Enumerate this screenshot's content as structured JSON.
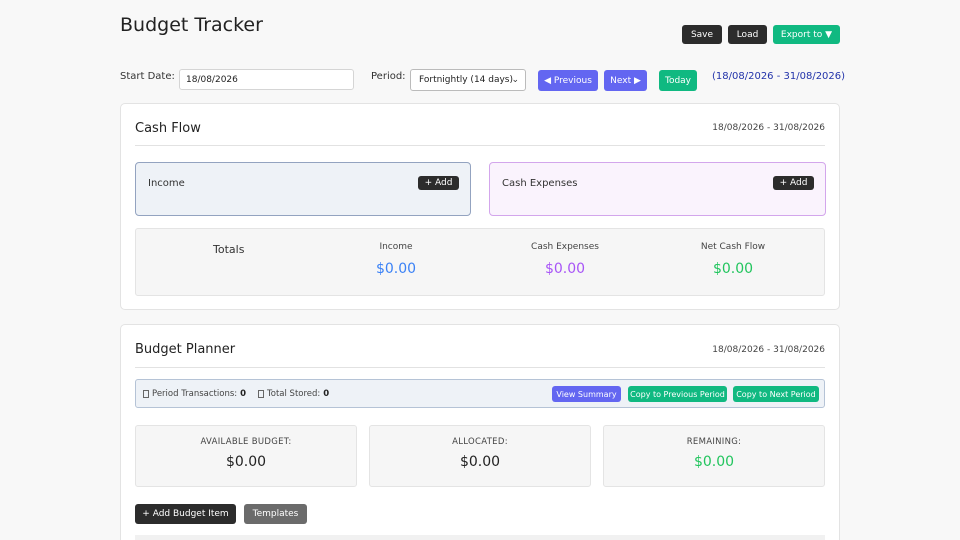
{
  "header": {
    "title": "Budget Tracker",
    "save_label": "Save",
    "load_label": "Load",
    "export_label": "Export to ▼"
  },
  "controls": {
    "start_date_label": "Start Date:",
    "start_date_value": "18/08/2026",
    "period_label": "Period:",
    "period_value": "Fortnightly (14 days)",
    "previous_label": "◀ Previous",
    "next_label": "Next ▶",
    "today_label": "Today",
    "range_text": "(18/08/2026 - 31/08/2026)"
  },
  "cash_flow": {
    "title": "Cash Flow",
    "date_range": "18/08/2026 - 31/08/2026",
    "income_label": "Income",
    "income_add": "+ Add",
    "expenses_label": "Cash Expenses",
    "expenses_add": "+ Add",
    "totals_label": "Totals",
    "income_head": "Income",
    "income_total": "$0.00",
    "expenses_head": "Cash Expenses",
    "expenses_total": "$0.00",
    "net_head": "Net Cash Flow",
    "net_total": "$0.00"
  },
  "budget_planner": {
    "title": "Budget Planner",
    "date_range": "18/08/2026 - 31/08/2026",
    "period_tx_label": "Period Transactions:",
    "period_tx_count": "0",
    "total_stored_label": "Total Stored:",
    "total_stored_count": "0",
    "view_summary": "View Summary",
    "copy_prev": "Copy to Previous Period",
    "copy_next": "Copy to Next Period",
    "available_label": "AVAILABLE BUDGET:",
    "available_value": "$0.00",
    "allocated_label": "ALLOCATED:",
    "allocated_value": "$0.00",
    "remaining_label": "REMAINING:",
    "remaining_value": "$0.00",
    "add_item": "+ Add Budget Item",
    "templates": "Templates"
  },
  "colors": {
    "income_blue": "#3b82f6",
    "expense_purple": "#a855f7",
    "positive_green": "#22c55e",
    "button_dark": "#2c2c2c",
    "button_green": "#10b981",
    "button_purple": "#6366f1"
  }
}
